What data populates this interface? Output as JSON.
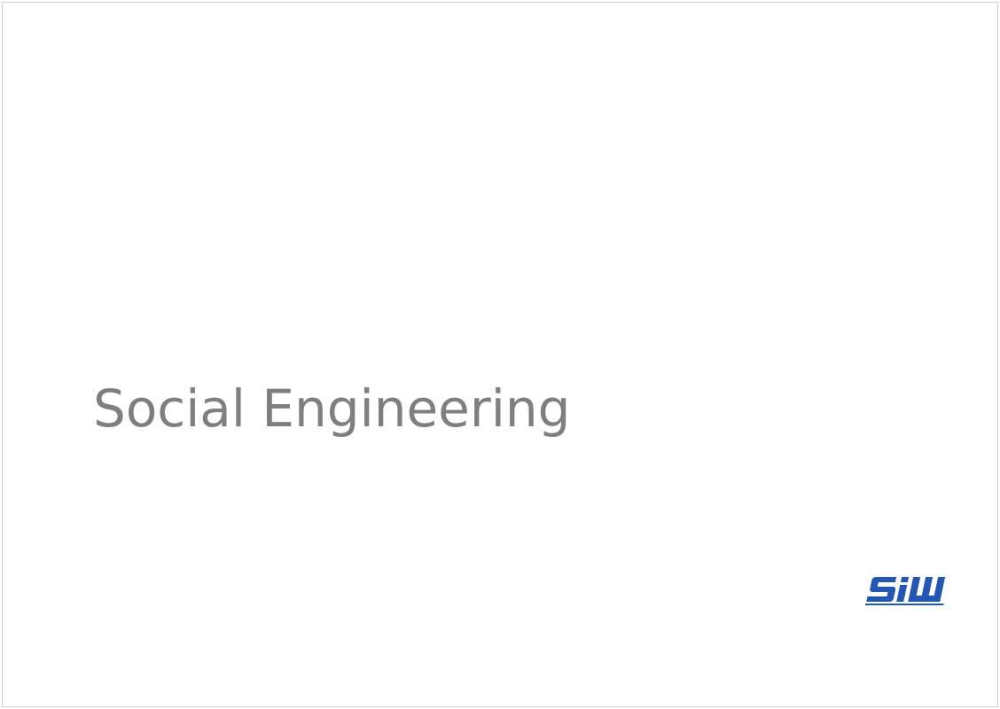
{
  "slide": {
    "title": "Social Engineering",
    "logo": {
      "text": "SIW",
      "color": "#2457b3"
    }
  },
  "colors": {
    "background": "#ffffff",
    "border": "#cfcfcf",
    "title_text": "#7f7f7f"
  }
}
